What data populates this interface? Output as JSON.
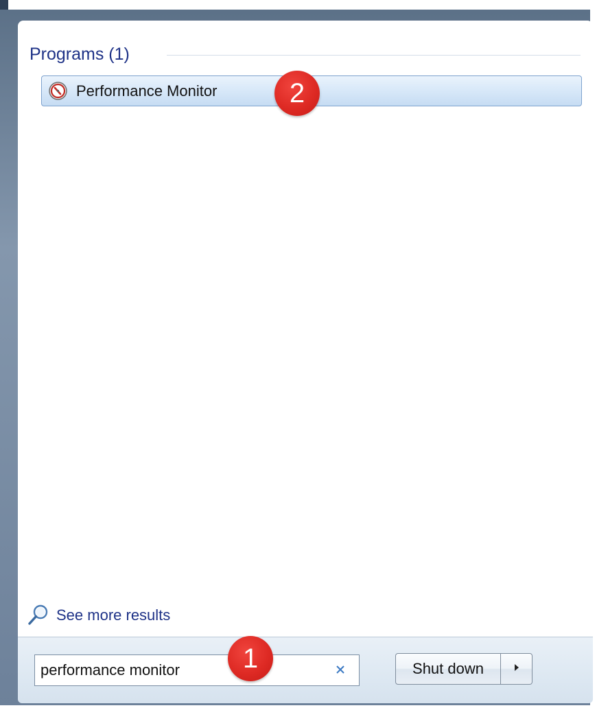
{
  "programs": {
    "header": "Programs (1)",
    "items": [
      {
        "label": "Performance Monitor",
        "icon": "performance-monitor-icon"
      }
    ]
  },
  "callouts": {
    "step1": "1",
    "step2": "2",
    "color": "#de2a24"
  },
  "see_more": {
    "label": "See more results",
    "icon": "search-icon"
  },
  "search": {
    "value": "performance monitor",
    "clear_icon": "clear-icon"
  },
  "shutdown": {
    "label": "Shut down",
    "arrow_icon": "chevron-right-icon"
  },
  "colors": {
    "accent_text": "#1e3287",
    "selection_border": "#7da2ce",
    "bottom_bar": "#dde8f2"
  }
}
